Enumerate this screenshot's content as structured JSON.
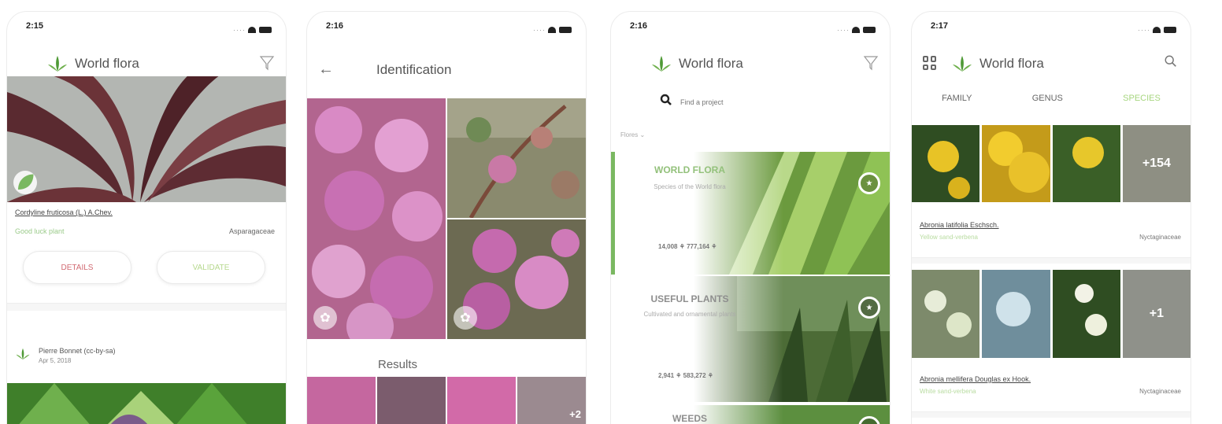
{
  "screens": [
    {
      "status": {
        "time": "2:15"
      },
      "header": {
        "title": "World flora"
      },
      "observation": {
        "scientific_name": "Cordyline fruticosa (L.) A.Chev.",
        "common_name": "Good luck plant",
        "family": "Asparagaceae",
        "details_label": "DETAILS",
        "validate_label": "VALIDATE",
        "author": "Pierre Bonnet (cc-by-sa)",
        "date": "Apr 5, 2018"
      }
    },
    {
      "status": {
        "time": "2:16"
      },
      "header": {
        "title": "Identification"
      },
      "results_label": "Results",
      "more_count": "+2"
    },
    {
      "status": {
        "time": "2:16"
      },
      "header": {
        "title": "World flora"
      },
      "search": {
        "placeholder": "Find a project"
      },
      "filter_label": "Flores",
      "cards": [
        {
          "title": "WORLD FLORA",
          "subtitle": "Species of the World flora",
          "stats": "14,008 ⚘ 777,164 ⚘"
        },
        {
          "title": "USEFUL PLANTS",
          "subtitle": "Cultivated and ornamental plants",
          "stats": "2,941 ⚘ 583,272 ⚘"
        },
        {
          "title": "WEEDS"
        }
      ]
    },
    {
      "status": {
        "time": "2:17"
      },
      "header": {
        "title": "World flora"
      },
      "tabs": [
        "FAMILY",
        "GENUS",
        "SPECIES"
      ],
      "species": [
        {
          "name": "Abronia latifolia Eschsch.",
          "common": "Yellow sand-verbena",
          "family": "Nyctaginaceae",
          "more": "+154"
        },
        {
          "name": "Abronia mellifera Douglas ex Hook.",
          "common": "White sand-verbena",
          "family": "Nyctaginaceae",
          "more": "+1"
        }
      ]
    }
  ],
  "colors": {
    "accent": "#8cc46a",
    "details": "#d26b73",
    "validate": "#b7d98f"
  }
}
